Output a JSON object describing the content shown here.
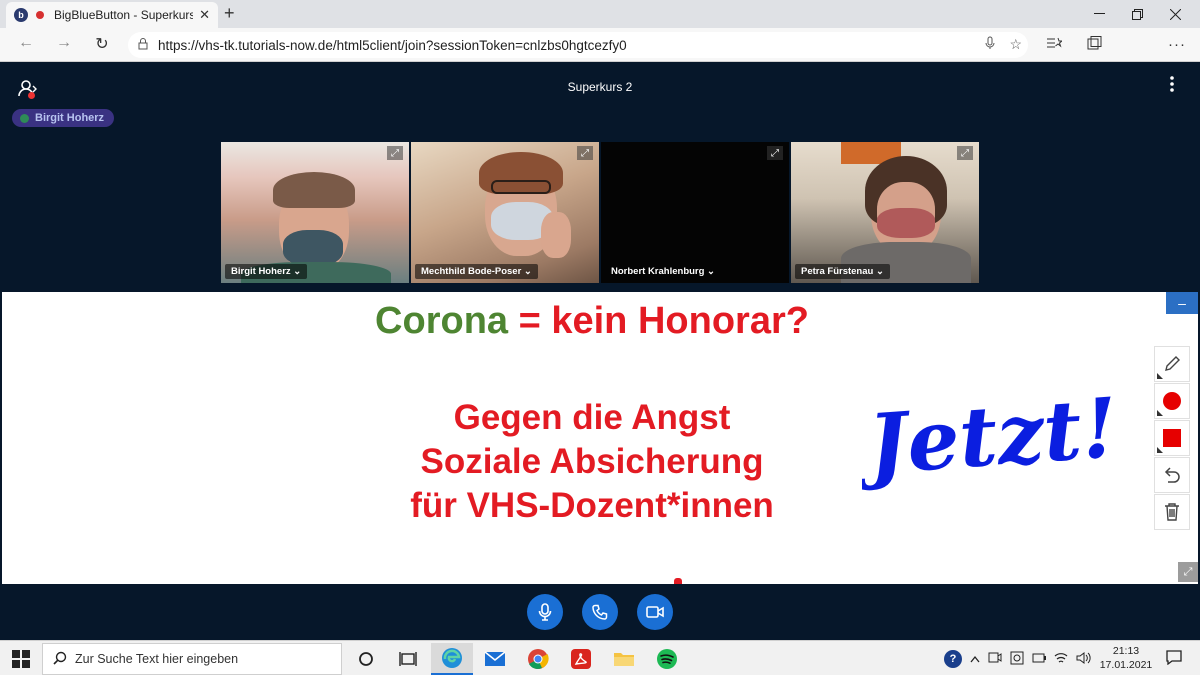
{
  "browser": {
    "tab_title": "BigBlueButton - Superkurs 2",
    "favicon_letter": "b",
    "tab_close": "✕",
    "new_tab": "+",
    "url": "https://vhs-tk.tutorials-now.de/html5client/join?sessionToken=cnlzbs0hgtcezfy0"
  },
  "header": {
    "meeting_title": "Superkurs 2",
    "talking_user": "Birgit Hoherz"
  },
  "webcams": [
    {
      "name": "Birgit Hoherz ⌄"
    },
    {
      "name": "Mechthild Bode-Poser ⌄"
    },
    {
      "name": "Norbert Krahlenburg ⌄"
    },
    {
      "name": "Petra Fürstenau ⌄"
    }
  ],
  "slide": {
    "line1_green": "Corona",
    "line1_red": " = kein Honorar?",
    "lines": [
      "Gegen die Angst",
      "Soziale Absicherung",
      "für VHS-Dozent*innen"
    ],
    "annotation": "Jetzt!",
    "annotation_color": "#0b1ee0"
  },
  "taskbar": {
    "search_placeholder": "Zur Suche Text hier eingeben",
    "time": "21:13",
    "date": "17.01.2021"
  },
  "colors": {
    "bbb_bg": "#06172a",
    "accent_blue": "#1a6fd4",
    "slide_red": "#e31b23",
    "slide_green": "#4e8532"
  }
}
